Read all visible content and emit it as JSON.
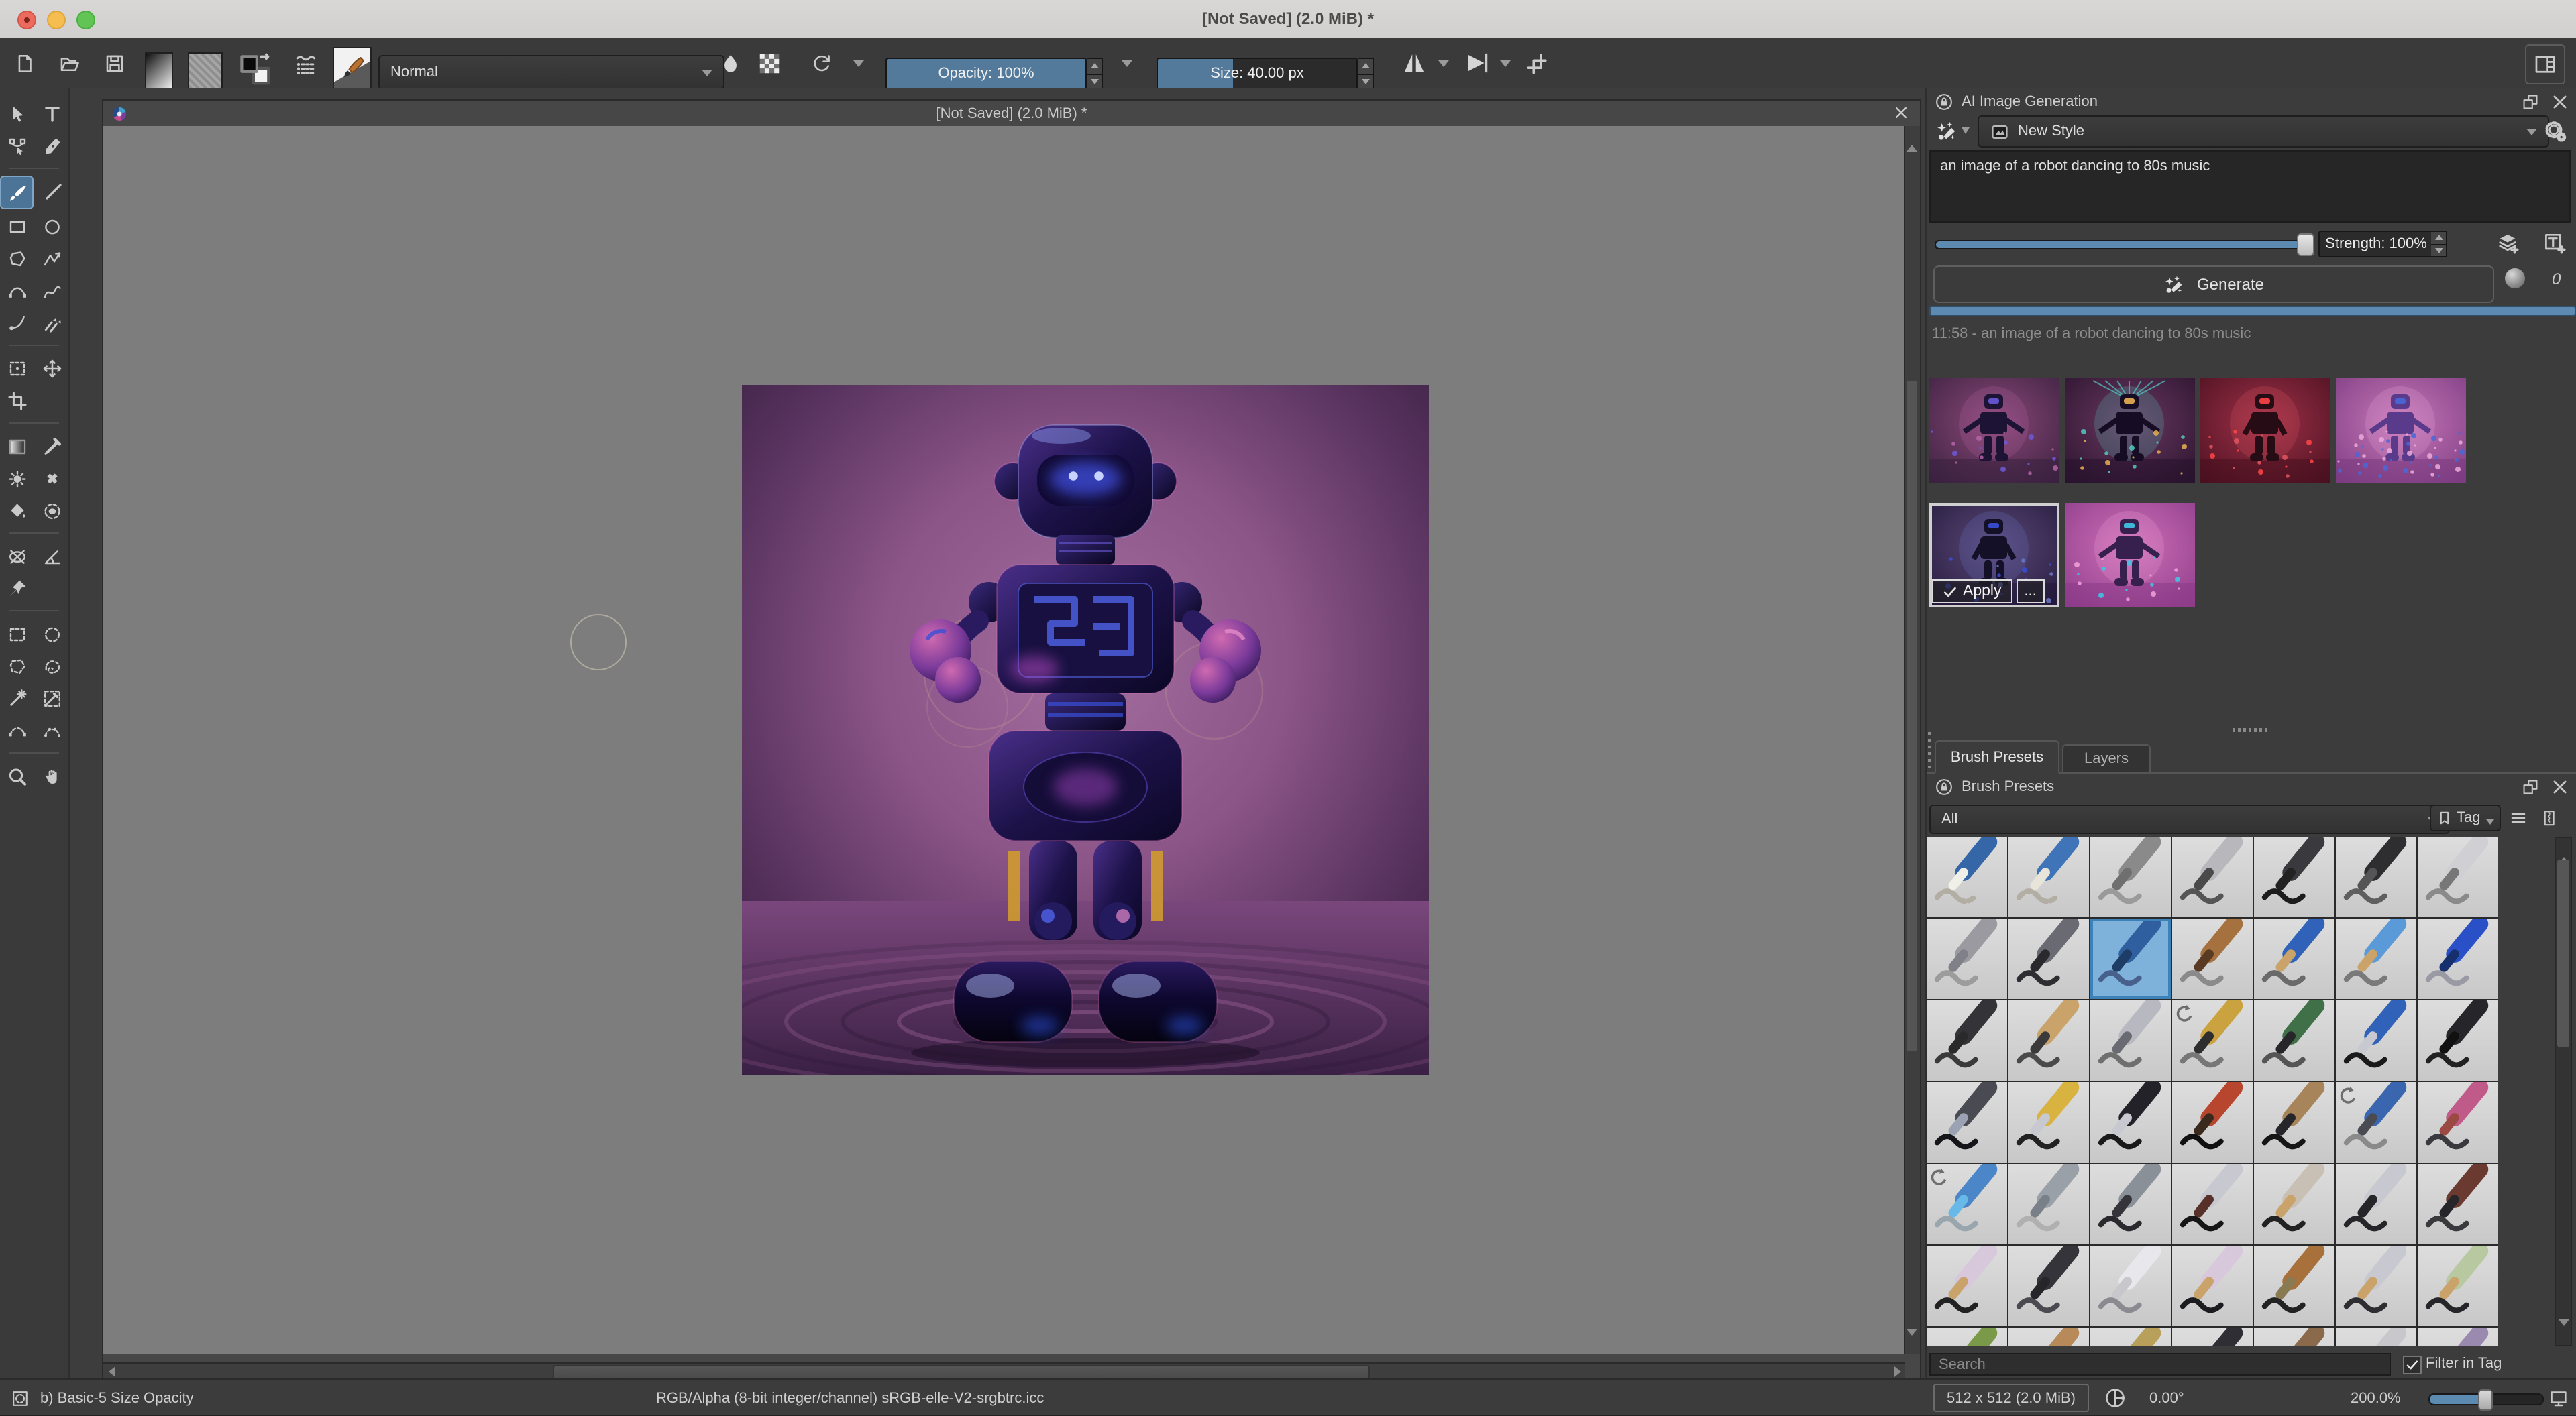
{
  "window": {
    "title": "[Not Saved]  (2.0 MiB) *"
  },
  "toolbar": {
    "blend_mode": "Normal",
    "opacity_label": "Opacity: 100%",
    "opacity_fill_pct": 100,
    "size_label": "Size: 40.00 px",
    "size_fill_pct": 38
  },
  "subwindow": {
    "title": "[Not Saved]  (2.0 MiB) *"
  },
  "toolbox": {
    "rows": [
      {
        "type": "row",
        "tools": [
          {
            "icon": "pointer",
            "name": "select-shapes"
          },
          {
            "icon": "text",
            "name": "text"
          }
        ]
      },
      {
        "type": "row",
        "tools": [
          {
            "icon": "node-edit",
            "name": "edit-shapes"
          },
          {
            "icon": "calligraphy",
            "name": "calligraphy"
          }
        ]
      },
      {
        "type": "sep"
      },
      {
        "type": "row",
        "tools": [
          {
            "icon": "brush-tool",
            "name": "freehand-brush",
            "selected": true
          },
          {
            "icon": "line",
            "name": "line"
          }
        ]
      },
      {
        "type": "row",
        "tools": [
          {
            "icon": "rect-tool",
            "name": "rectangle"
          },
          {
            "icon": "ellipse-tool",
            "name": "ellipse"
          }
        ]
      },
      {
        "type": "row",
        "tools": [
          {
            "icon": "polygon-tool",
            "name": "polygon"
          },
          {
            "icon": "polyline-tool",
            "name": "polyline"
          }
        ]
      },
      {
        "type": "row",
        "tools": [
          {
            "icon": "bezier-tool",
            "name": "bezier-curve"
          },
          {
            "icon": "freehand-path",
            "name": "freehand-path"
          }
        ]
      },
      {
        "type": "row",
        "tools": [
          {
            "icon": "dynamic-brush",
            "name": "dynamic-brush"
          },
          {
            "icon": "multibrush",
            "name": "multibrush"
          }
        ]
      },
      {
        "type": "sep"
      },
      {
        "type": "row",
        "tools": [
          {
            "icon": "transform-tool",
            "name": "transform"
          },
          {
            "icon": "move-tool",
            "name": "move"
          }
        ]
      },
      {
        "type": "row",
        "tools": [
          {
            "icon": "crop-tool",
            "name": "crop"
          },
          null
        ]
      },
      {
        "type": "sep"
      },
      {
        "type": "row",
        "tools": [
          {
            "icon": "gradient-tool",
            "name": "gradient"
          },
          {
            "icon": "picker-tool",
            "name": "color-sampler"
          }
        ]
      },
      {
        "type": "row",
        "tools": [
          {
            "icon": "colorize-tool",
            "name": "colorize-mask"
          },
          {
            "icon": "smart-patch",
            "name": "smart-patch"
          }
        ]
      },
      {
        "type": "row",
        "tools": [
          {
            "icon": "fill-tool",
            "name": "fill"
          },
          {
            "icon": "enclose-fill",
            "name": "enclose-and-fill"
          }
        ]
      },
      {
        "type": "sep"
      },
      {
        "type": "row",
        "tools": [
          {
            "icon": "assistants-tool",
            "name": "assistants"
          },
          {
            "icon": "measure-tool",
            "name": "measure"
          }
        ]
      },
      {
        "type": "row",
        "tools": [
          {
            "icon": "reference-tool",
            "name": "reference-images"
          },
          null
        ]
      },
      {
        "type": "sep"
      },
      {
        "type": "row",
        "tools": [
          {
            "icon": "select-rect",
            "name": "rectangular-selection"
          },
          {
            "icon": "select-ellipse",
            "name": "elliptical-selection"
          }
        ]
      },
      {
        "type": "row",
        "tools": [
          {
            "icon": "select-poly",
            "name": "polygonal-selection"
          },
          {
            "icon": "select-freehand",
            "name": "freehand-selection"
          }
        ]
      },
      {
        "type": "row",
        "tools": [
          {
            "icon": "select-similar",
            "name": "contiguous-selection"
          },
          {
            "icon": "select-picker",
            "name": "similar-color-selection"
          }
        ]
      },
      {
        "type": "row",
        "tools": [
          {
            "icon": "select-bezier",
            "name": "bezier-selection"
          },
          {
            "icon": "select-magnetic",
            "name": "magnetic-selection"
          }
        ]
      },
      {
        "type": "sep"
      },
      {
        "type": "row",
        "tools": [
          {
            "icon": "zoom-tool",
            "name": "zoom"
          },
          {
            "icon": "pan-tool",
            "name": "pan"
          }
        ]
      }
    ]
  },
  "ai_panel": {
    "title": "AI Image Generation",
    "style_name": "New Style",
    "prompt": "an image of a robot dancing to 80s music",
    "strength_label": "Strength: 100%",
    "strength_fill_pct": 100,
    "generate_label": "Generate",
    "queue_count": "0",
    "history_label": "11:58 - an image of a robot dancing to 80s music",
    "apply_label": "Apply",
    "more_label": "...",
    "progress_pct": 100,
    "thumbnails": [
      {
        "name": "result-1",
        "bg1": "#8a4878",
        "bg2": "#38203e",
        "body": "#1d1334",
        "glow": "#b465a5",
        "accent": "#6a5ad8",
        "pose": "arms-out",
        "selected": false
      },
      {
        "name": "result-2",
        "bg1": "#6a3860",
        "bg2": "#27122c",
        "body": "#160d24",
        "glow": "#55c8c0",
        "accent": "#e8b050",
        "pose": "rays",
        "selected": false
      },
      {
        "name": "result-3",
        "bg1": "#a03048",
        "bg2": "#47101f",
        "body": "#260c14",
        "glow": "#e05560",
        "accent": "#ff4545",
        "pose": "arms-bent",
        "selected": false
      },
      {
        "name": "result-4",
        "bg1": "#c878b8",
        "bg2": "#7a3a80",
        "body": "#5a3a8a",
        "glow": "#eaaada",
        "accent": "#4868d8",
        "pose": "glitch",
        "selected": false
      },
      {
        "name": "result-5",
        "bg1": "#5a4878",
        "bg2": "#221838",
        "body": "#141028",
        "glow": "#6a78c8",
        "accent": "#3a4fd8",
        "pose": "compact",
        "selected": true
      },
      {
        "name": "result-6",
        "bg1": "#d070b8",
        "bg2": "#8a3a88",
        "body": "#38204e",
        "glow": "#f2a2da",
        "accent": "#40c8e8",
        "pose": "arms-out",
        "selected": false
      }
    ]
  },
  "tabs": {
    "brush_presets": "Brush Presets",
    "layers": "Layers"
  },
  "brush_panel": {
    "title": "Brush Presets",
    "filter_value": "All",
    "tag_label": "Tag",
    "search_placeholder": "Search",
    "filter_checkbox_label": "Filter in Tag",
    "presets": [
      {
        "name": "eraser-small",
        "body": "#3566a8",
        "tip": "#f0efe8",
        "stroke": "checker"
      },
      {
        "name": "eraser-soft",
        "body": "#3f74b8",
        "tip": "#e8e4da",
        "stroke": "checker"
      },
      {
        "name": "smudge-soft",
        "body": "#8a8a8a",
        "tip": "#6f6f6f",
        "stroke": "#9a9a9a"
      },
      {
        "name": "airbrush-soft",
        "body": "#b8b8bc",
        "tip": "#4a4a4a",
        "stroke": "#555555"
      },
      {
        "name": "ink-pen",
        "body": "#3a3a3e",
        "tip": "#222222",
        "stroke": "#1c1c1c"
      },
      {
        "name": "pencil-soft",
        "body": "#2e2e31",
        "tip": "#555555",
        "stroke": "#5f5f5f"
      },
      {
        "name": "pen-soft",
        "body": "#cfcfd4",
        "tip": "#777777",
        "stroke": "#8a8a8a"
      },
      {
        "name": "stylus",
        "body": "#9a9aa0",
        "tip": "#808088",
        "stroke": "#9c9c9c"
      },
      {
        "name": "ink-brush",
        "body": "#6a6a72",
        "tip": "#2a2a2e",
        "stroke": "#2e2e32"
      },
      {
        "name": "basic-5-size-opacity",
        "body": "#2f5f9e",
        "tip": "#1d3c66",
        "stroke": "#47618c",
        "selected": true
      },
      {
        "name": "watercolor",
        "body": "#a5713f",
        "tip": "#5a3a22",
        "stroke": "#8a8a8a"
      },
      {
        "name": "pencil-blue",
        "body": "#2f62b8",
        "tip": "#caa36a",
        "stroke": "#6a6a6a"
      },
      {
        "name": "pencil-sky",
        "body": "#5a9ad8",
        "tip": "#caa36a",
        "stroke": "#7a7a7a"
      },
      {
        "name": "ballpoint",
        "body": "#2a50c8",
        "tip": "#16306e",
        "stroke": "#9a9aa4"
      },
      {
        "name": "pencil-2b",
        "body": "#333338",
        "tip": "#2a2a2a",
        "stroke": "#3a3a3a"
      },
      {
        "name": "pencil-hb",
        "body": "#caa36a",
        "tip": "#3a3a3a",
        "stroke": "#4a4a4a"
      },
      {
        "name": "pen-nib",
        "body": "#b8b8c0",
        "tip": "#6a6a72",
        "stroke": "#6f6f6f"
      },
      {
        "name": "pencil-stub",
        "body": "#caa340",
        "tip": "#2e2e2e",
        "stroke": "#777777",
        "rotate": true
      },
      {
        "name": "pencil-bundle",
        "body": "#3f7048",
        "tip": "#26262a",
        "stroke": "#555555"
      },
      {
        "name": "fountain-pen",
        "body": "#2f62b8",
        "tip": "#c8c8d0",
        "stroke": "#1a1a1a"
      },
      {
        "name": "fineliner",
        "body": "#26262a",
        "tip": "#111111",
        "stroke": "#222222"
      },
      {
        "name": "mech-pencil",
        "body": "#4a4a52",
        "tip": "#9aa2b4",
        "stroke": "#16161a"
      },
      {
        "name": "dip-pen",
        "body": "#d8b33f",
        "tip": "#c8c8d0",
        "stroke": "#222222"
      },
      {
        "name": "fountain-black",
        "body": "#222228",
        "tip": "#c8c8d0",
        "stroke": "#1a1a1a"
      },
      {
        "name": "brush-detail",
        "body": "#b8462f",
        "tip": "#3a2a1e",
        "stroke": "#111111"
      },
      {
        "name": "brush-krita",
        "body": "#a8845a",
        "tip": "#26262a",
        "stroke": "#161616"
      },
      {
        "name": "marker-blue",
        "body": "#3a66b0",
        "tip": "#4a4a52",
        "stroke": "#8a8a8a",
        "rotate": true
      },
      {
        "name": "marker-pink",
        "body": "#c05a88",
        "tip": "#9a4a42",
        "stroke": "#3a3a3e"
      },
      {
        "name": "highlighter-blue",
        "body": "#4a86c8",
        "tip": "#68b8e8",
        "stroke": "#9aa6ae",
        "rotate": true
      },
      {
        "name": "marker-grey",
        "body": "#9aa0a8",
        "tip": "#7a8088",
        "stroke": "#b0b0b0"
      },
      {
        "name": "marker-dark",
        "body": "#8a9098",
        "tip": "#34343a",
        "stroke": "#2a2a2e"
      },
      {
        "name": "brush-slim",
        "body": "#c8c8d0",
        "tip": "#58302a",
        "stroke": "#161616"
      },
      {
        "name": "brush-bristle",
        "body": "#c8c0b4",
        "tip": "#caa36a",
        "stroke": "#222222"
      },
      {
        "name": "brush-flat-big",
        "body": "#c8c8d0",
        "tip": "#26262a",
        "stroke": "#26262a"
      },
      {
        "name": "brush-round",
        "body": "#6a3a30",
        "tip": "#26262a",
        "stroke": "#3a3a3e"
      },
      {
        "name": "brush-flat",
        "body": "#d8c8dc",
        "tip": "#caa36a",
        "stroke": "#222222"
      },
      {
        "name": "charcoal-chunk",
        "body": "#34343a",
        "tip": "#26262a",
        "stroke": "#4a4a50"
      },
      {
        "name": "paint-roller",
        "body": "#e8e8ec",
        "tip": "#c8c8cc",
        "stroke": "#8a8a90"
      },
      {
        "name": "brush-fan",
        "body": "#d8c8dc",
        "tip": "#caa36a",
        "stroke": "#1c1c20"
      },
      {
        "name": "brush-old",
        "body": "#a8703a",
        "tip": "#8a7a52",
        "stroke": "#222222"
      },
      {
        "name": "brush-thin",
        "body": "#c8c8d0",
        "tip": "#caa36a",
        "stroke": "#2e2e32"
      },
      {
        "name": "brush-multi",
        "body": "#b8c8a0",
        "tip": "#caa36a",
        "stroke": "#26262a"
      },
      {
        "name": "pencil-green",
        "body": "#7a9a4a",
        "tip": "#5a7a3a",
        "stroke": "#555555"
      },
      {
        "name": "chalk",
        "body": "#b88a5a",
        "tip": "#a87a4a",
        "stroke": "#777777"
      },
      {
        "name": "pastel-gold",
        "body": "#b8a05a",
        "tip": "#9a8a4a",
        "stroke": "#888888"
      },
      {
        "name": "charcoal-stick",
        "body": "#2e2e34",
        "tip": "#222222",
        "stroke": "#444444"
      },
      {
        "name": "stick-brown",
        "body": "#8a6a4a",
        "tip": "#7a5a3a",
        "stroke": "#666666"
      },
      {
        "name": "pencil-silver",
        "body": "#c8c8cc",
        "tip": "#b0b0b4",
        "stroke": "#999999"
      },
      {
        "name": "wet-brush",
        "body": "#9a8ab0",
        "tip": "#58a8d8",
        "stroke": "#444444"
      }
    ]
  },
  "statusbar": {
    "brush_name": "b) Basic-5 Size Opacity",
    "colorspace": "RGB/Alpha (8-bit integer/channel)  sRGB-elle-V2-srgbtrc.icc",
    "canvas_size": "512 x 512 (2.0 MiB)",
    "rotation": "0.00°",
    "zoom_level": "200.0%"
  },
  "canvas_image": {
    "description": "glossy purple-chrome toy robot standing on a rippled purple floor, 512x512 shown at 200%",
    "palette": {
      "background_center": "#a36f9f",
      "background_edge": "#341d3c",
      "robot_dark": "#0c0726",
      "robot_indigo": "#34206b",
      "glow_blue": "#4a5ae8",
      "glow_pink": "#d06ab0",
      "accent_yellow": "#cf9b2f"
    }
  },
  "colors": {
    "titlebar": "#d6d3d2",
    "toolbar_bg": "#3a3a3a",
    "panel_bg": "#3c3c3c",
    "canvas_gray": "#7d7d7d",
    "accent_blue": "#53799b",
    "progress_blue": "#5d8ab0",
    "selection_blue": "#7fb2da"
  }
}
